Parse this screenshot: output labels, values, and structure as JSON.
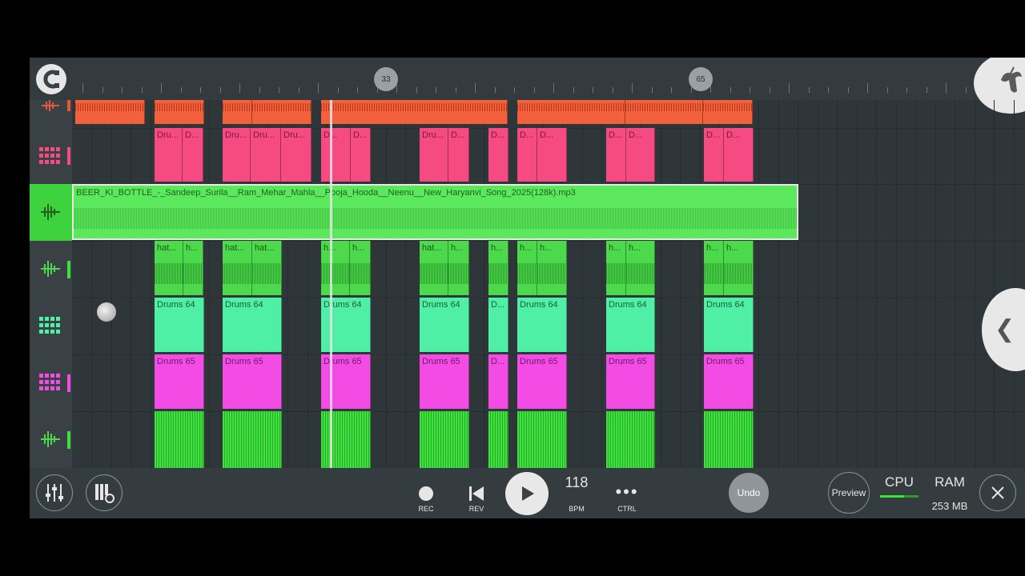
{
  "ruler": {
    "markers": [
      "33",
      "65"
    ]
  },
  "tracks": [
    {
      "type": "audio"
    },
    {
      "type": "pattern",
      "clips": [
        {
          "label": "Dru..."
        },
        {
          "label": "D..."
        },
        {
          "label": "Dru..."
        },
        {
          "label": "Dru..."
        },
        {
          "label": "Dru..."
        },
        {
          "label": "D..."
        },
        {
          "label": "D..."
        },
        {
          "label": "Dru..."
        },
        {
          "label": "D..."
        },
        {
          "label": "D..."
        },
        {
          "label": "D..."
        },
        {
          "label": "D..."
        },
        {
          "label": "D..."
        },
        {
          "label": "D..."
        },
        {
          "label": "D..."
        },
        {
          "label": "D..."
        }
      ]
    },
    {
      "type": "audio",
      "clip_label": "BEER_KI_BOTTLE_-_Sandeep_Surila__Ram_Mehar_Mahla__Pooja_Hooda__Neenu__New_Haryanvi_Song_2025(128k).mp3"
    },
    {
      "type": "audio",
      "clips": [
        {
          "label": "hat..."
        },
        {
          "label": "h..."
        },
        {
          "label": "hat..."
        },
        {
          "label": "hat..."
        },
        {
          "label": "h..."
        },
        {
          "label": "h..."
        },
        {
          "label": "hat..."
        },
        {
          "label": "h..."
        },
        {
          "label": "h..."
        },
        {
          "label": "h..."
        },
        {
          "label": "h..."
        },
        {
          "label": "h..."
        },
        {
          "label": "h..."
        },
        {
          "label": "h..."
        },
        {
          "label": "h..."
        }
      ]
    },
    {
      "type": "pattern",
      "clips": [
        {
          "label": "Drums 64"
        },
        {
          "label": "Drums 64"
        },
        {
          "label": "Drums 64"
        },
        {
          "label": "Drums 64"
        },
        {
          "label": "D..."
        },
        {
          "label": "Drums 64"
        },
        {
          "label": "Drums 64"
        },
        {
          "label": "Drums 64"
        }
      ]
    },
    {
      "type": "pattern",
      "clips": [
        {
          "label": "Drums 65"
        },
        {
          "label": "Drums 65"
        },
        {
          "label": "Drums 65"
        },
        {
          "label": "Drums 65"
        },
        {
          "label": "D..."
        },
        {
          "label": "Drums 65"
        },
        {
          "label": "Drums 65"
        },
        {
          "label": "Drums 65"
        }
      ]
    },
    {
      "type": "audio"
    }
  ],
  "toolbar": {
    "rec_label": "REC",
    "rev_label": "REV",
    "bpm_value": "118",
    "bpm_label": "BPM",
    "ctrl_label": "CTRL",
    "undo_label": "Undo",
    "preview_label": "Preview",
    "cpu_label": "CPU",
    "ram_label": "RAM",
    "ram_value": "253 MB"
  },
  "icons": {
    "magnet": "magnet-icon",
    "logo": "fl-fruit-logo-icon",
    "mixer": "mixer-icon",
    "piano": "piano-settings-icon",
    "play": "play-icon",
    "rewind": "skip-back-icon",
    "close": "close-icon",
    "collapse": "chevron-left-icon"
  },
  "colors": {
    "audio_orange": "#f2603c",
    "pattern_pink": "#f64a82",
    "audio_selected_green": "#5ce85c",
    "hat_green": "#4cd94c",
    "pattern_mint": "#4ff0a6",
    "pattern_magenta": "#f24ce4",
    "track_green": "#3ee23e"
  }
}
